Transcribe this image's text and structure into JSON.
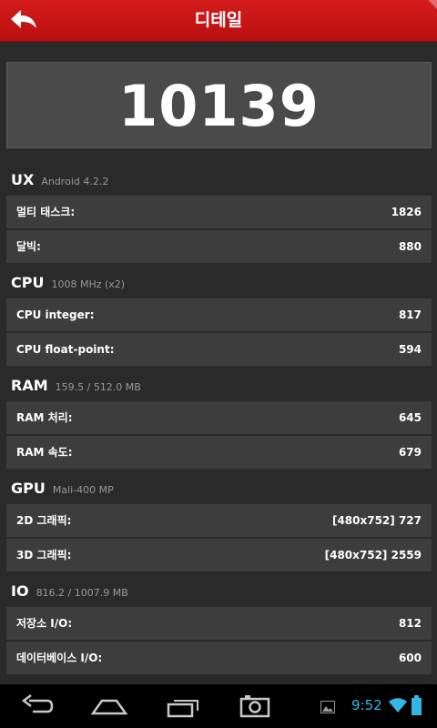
{
  "header": {
    "title": "디테일",
    "back_icon": "back-arrow-icon"
  },
  "score": {
    "value": "10139"
  },
  "sections": [
    {
      "name": "UX",
      "subtitle": "Android 4.2.2",
      "rows": [
        {
          "label": "멀티 태스크:",
          "value": "1826"
        },
        {
          "label": "달빅:",
          "value": "880"
        }
      ]
    },
    {
      "name": "CPU",
      "subtitle": "1008 MHz (x2)",
      "rows": [
        {
          "label": "CPU integer:",
          "value": "817"
        },
        {
          "label": "CPU float-point:",
          "value": "594"
        }
      ]
    },
    {
      "name": "RAM",
      "subtitle": "159.5 / 512.0 MB",
      "rows": [
        {
          "label": "RAM 처리:",
          "value": "645"
        },
        {
          "label": "RAM 속도:",
          "value": "679"
        }
      ]
    },
    {
      "name": "GPU",
      "subtitle": "Mali-400 MP",
      "rows": [
        {
          "label": "2D 그래픽:",
          "value": "[480x752] 727"
        },
        {
          "label": "3D 그래픽:",
          "value": "[480x752] 2559"
        }
      ]
    },
    {
      "name": "IO",
      "subtitle": "816.2 / 1007.9 MB",
      "rows": [
        {
          "label": "저장소 I/O:",
          "value": "812"
        },
        {
          "label": "데이터베이스 I/O:",
          "value": "600"
        }
      ]
    }
  ],
  "navbar": {
    "back_icon": "nav-back-icon",
    "home_icon": "home-icon",
    "recents_icon": "recent-apps-icon",
    "screenshot_icon": "camera-icon",
    "notification_icon": "image-notification-icon",
    "time": "9:52",
    "wifi_icon": "wifi-icon",
    "battery_icon": "battery-icon"
  },
  "colors": {
    "titlebar": "#c81414",
    "background": "#2a2a2a",
    "row": "#3d3d3d",
    "score_panel": "#4a4a4a",
    "clock": "#33b5e5"
  }
}
